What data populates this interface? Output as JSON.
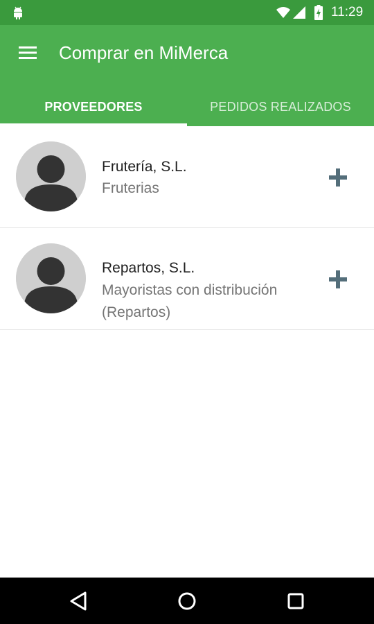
{
  "status_bar": {
    "time": "11:29",
    "icons": [
      "android-icon",
      "wifi-icon",
      "signal-icon",
      "battery-icon"
    ]
  },
  "app_bar": {
    "title": "Comprar en MiMerca",
    "menu_icon": "menu-icon",
    "color": "#4caf50"
  },
  "tabs": [
    {
      "label": "PROVEEDORES",
      "active": true
    },
    {
      "label": "PEDIDOS REALIZADOS",
      "active": false
    }
  ],
  "providers": [
    {
      "name": "Frutería, S.L.",
      "category": "Fruterias",
      "avatar_icon": "person-icon",
      "action_icon": "add-icon"
    },
    {
      "name": "Repartos, S.L.",
      "category": "Mayoristas con distribución (Repartos)",
      "avatar_icon": "person-icon",
      "action_icon": "add-icon"
    }
  ],
  "nav_bar": {
    "buttons": [
      "back-icon",
      "home-icon",
      "recent-apps-icon"
    ]
  }
}
